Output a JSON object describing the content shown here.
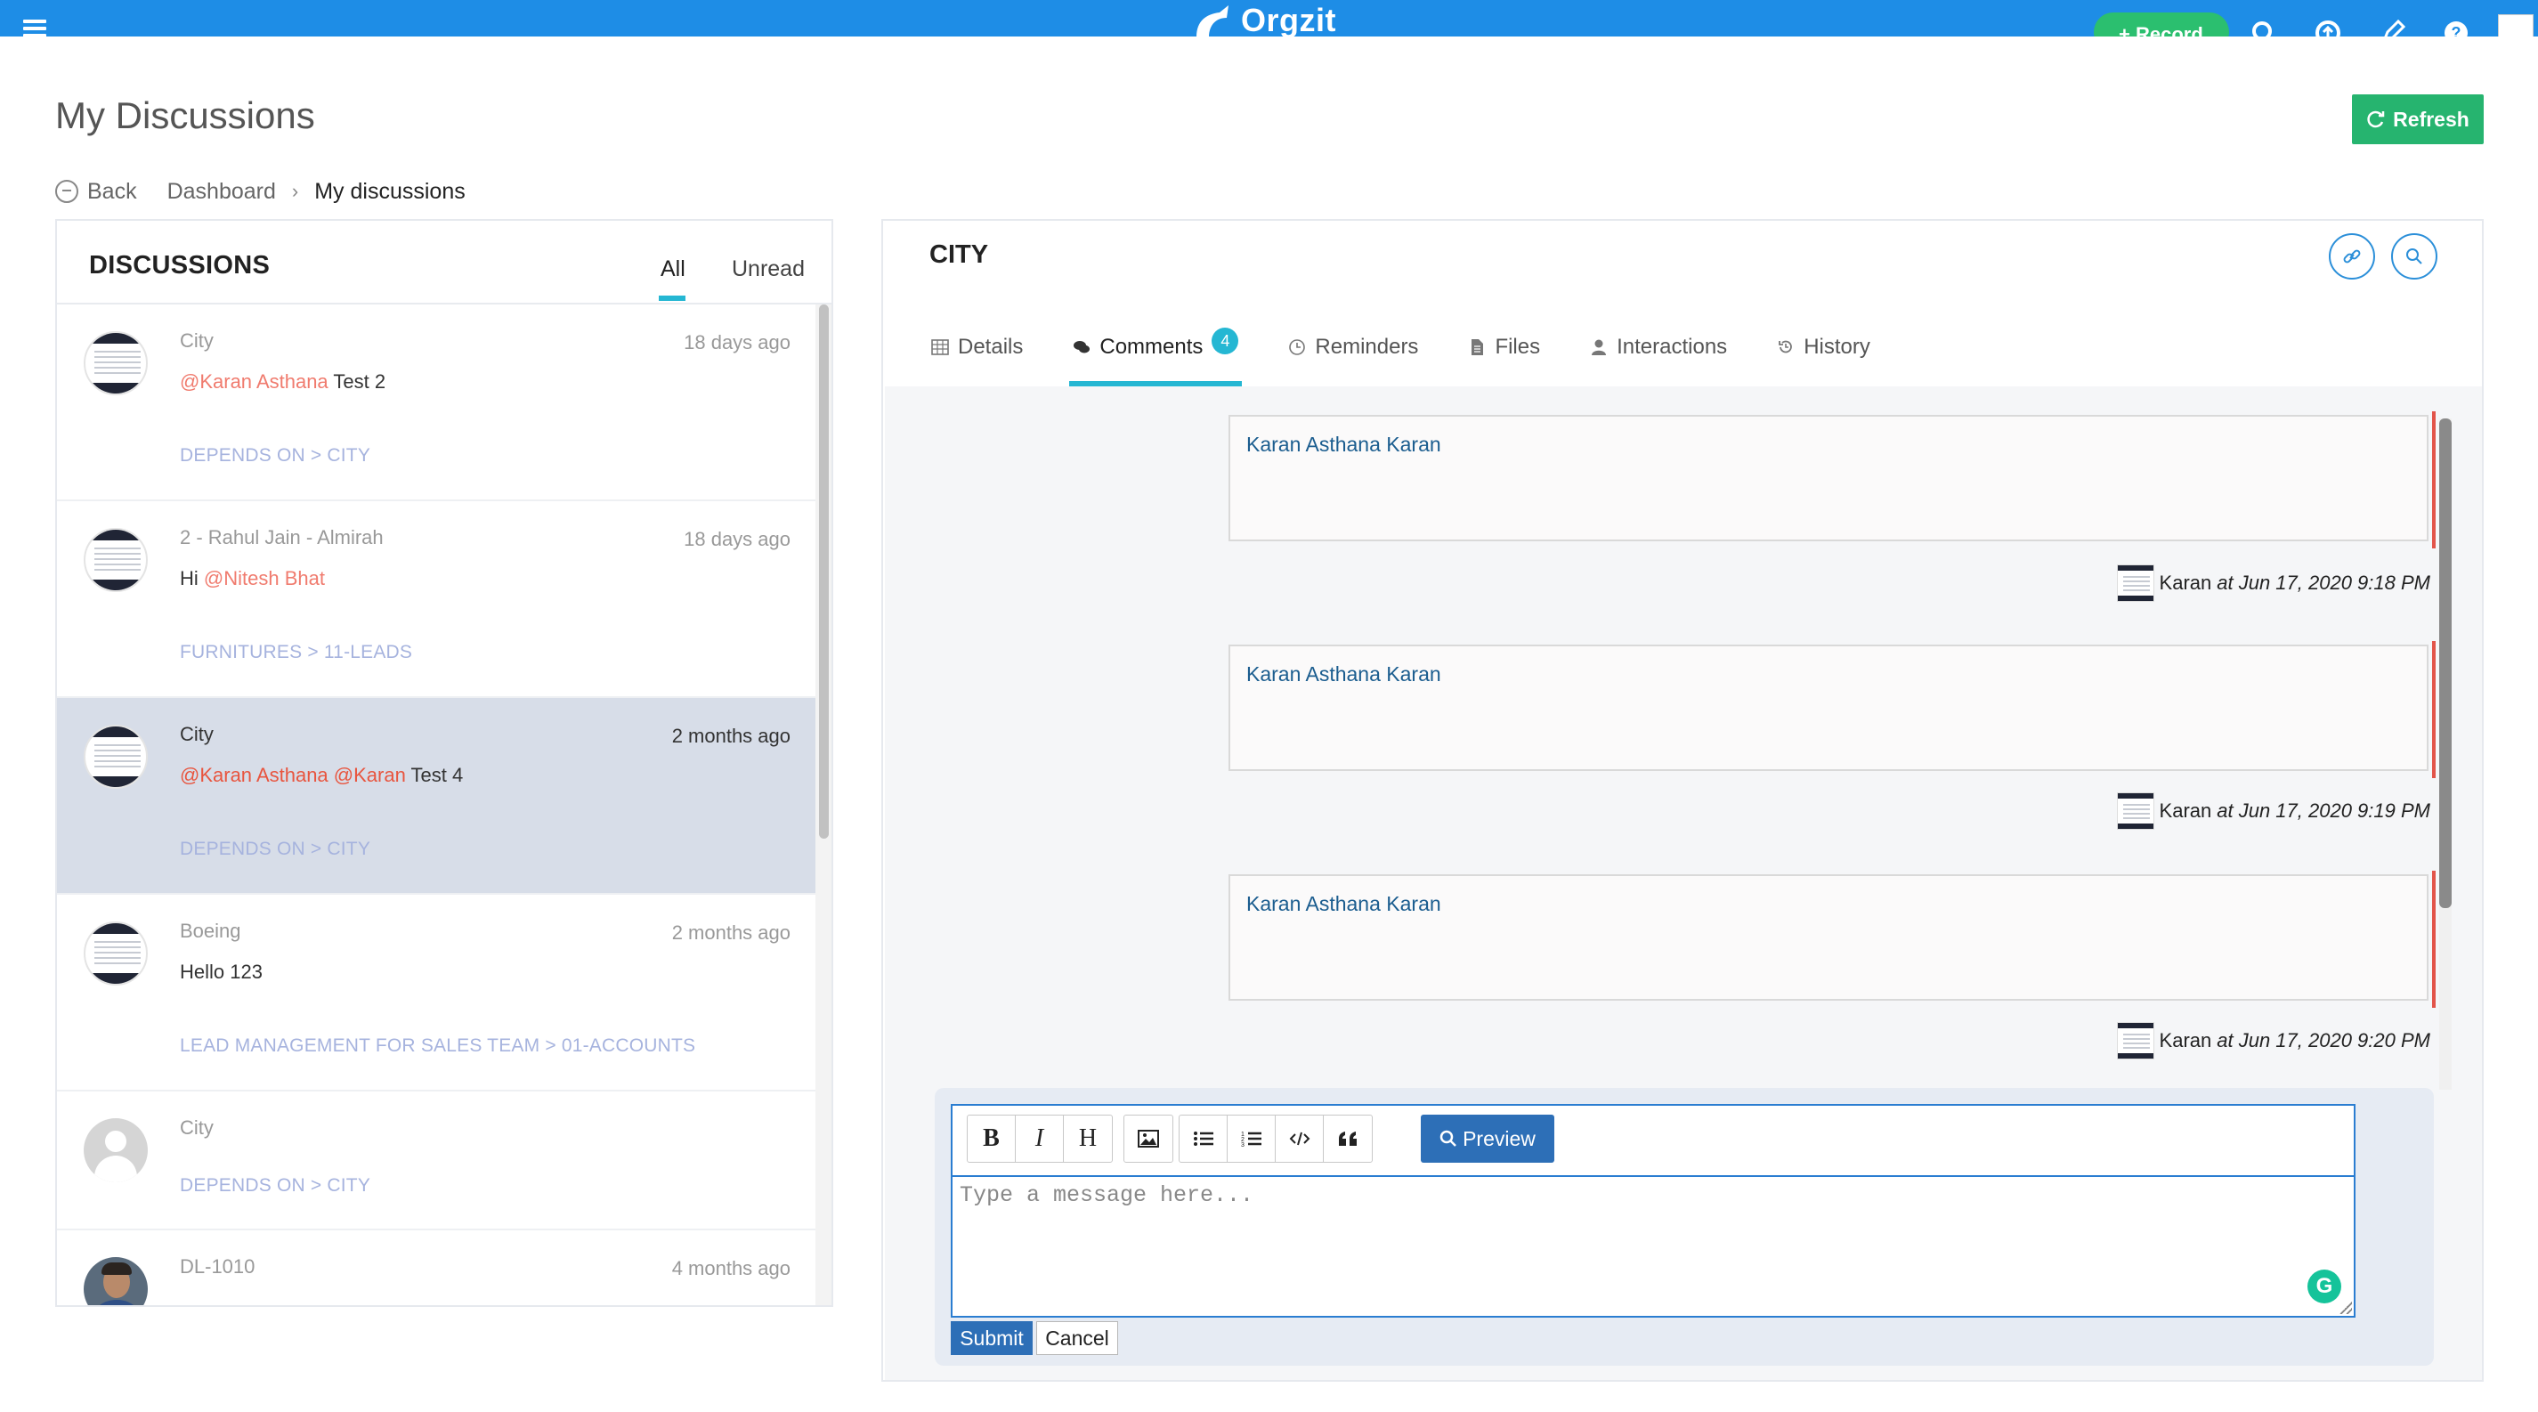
{
  "topbar": {
    "brand": "Orgzit",
    "record_label": "Record",
    "colors": {
      "bar": "#1e8de6",
      "record": "#2bbf6f"
    },
    "icons": [
      "menu-icon",
      "search-icon",
      "help-circle-icon",
      "edit-icon",
      "question-icon",
      "user-avatar"
    ]
  },
  "page": {
    "title": "My Discussions",
    "refresh_label": "Refresh"
  },
  "breadcrumb": {
    "back": "Back",
    "dashboard": "Dashboard",
    "current": "My discussions"
  },
  "discussions": {
    "heading": "DISCUSSIONS",
    "tab_all": "All",
    "tab_unread": "Unread",
    "items": [
      {
        "title": "City",
        "time": "18 days ago",
        "msg_pre": "",
        "mention": "@Karan Asthana",
        "msg_post": " Test 2",
        "link": "DEPENDS ON > CITY"
      },
      {
        "title": "2 - Rahul Jain - Almirah",
        "time": "18 days ago",
        "msg_pre": "Hi ",
        "mention": "@Nitesh Bhat",
        "msg_post": "",
        "link": "FURNITURES > 11-LEADS"
      },
      {
        "title": "City",
        "time": "2 months ago",
        "msg_pre": "",
        "mention": "@Karan Asthana @Karan",
        "msg_post": " Test 4",
        "link": "DEPENDS ON > CITY"
      },
      {
        "title": "Boeing",
        "time": "2 months ago",
        "msg_pre": "Hello 123",
        "mention": "",
        "msg_post": "",
        "link": "LEAD MANAGEMENT FOR SALES TEAM > 01-ACCOUNTS"
      },
      {
        "title": "City",
        "time": "",
        "msg_pre": "",
        "mention": "",
        "msg_post": "",
        "link": "DEPENDS ON > CITY"
      },
      {
        "title": "DL-1010",
        "time": "4 months ago",
        "msg_pre": "",
        "mention": "",
        "msg_post": "",
        "link": ""
      }
    ]
  },
  "record": {
    "title": "CITY",
    "tabs": {
      "details": "Details",
      "comments": "Comments",
      "comments_count": "4",
      "reminders": "Reminders",
      "files": "Files",
      "interactions": "Interactions",
      "history": "History"
    },
    "comments": [
      {
        "text": "Karan Asthana Karan",
        "author": "Karan",
        "at": "at Jun 17, 2020 9:18 PM"
      },
      {
        "text": "Karan Asthana Karan",
        "author": "Karan",
        "at": "at Jun 17, 2020 9:19 PM"
      },
      {
        "text": "Karan Asthana Karan",
        "author": "Karan",
        "at": "at Jun 17, 2020 9:20 PM"
      }
    ]
  },
  "editor": {
    "bold": "B",
    "italic": "I",
    "heading": "H",
    "preview_label": "Preview",
    "placeholder": "Type a message here...",
    "value": "",
    "submit_label": "Submit",
    "cancel_label": "Cancel",
    "colors": {
      "accent": "#2a7dd1",
      "grammarly": "#15c39a"
    }
  }
}
